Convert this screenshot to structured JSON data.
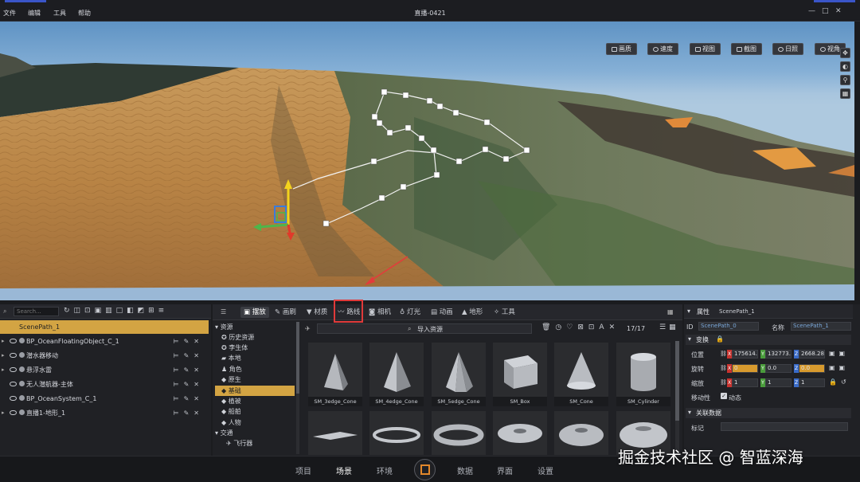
{
  "menu": {
    "items": [
      "文件",
      "编辑",
      "工具",
      "帮助"
    ],
    "title": "直播-0421",
    "window_controls": [
      "—",
      "□",
      "✕"
    ]
  },
  "viewport_toolbar": {
    "buttons": [
      {
        "label": "画质",
        "icon": "quality-icon"
      },
      {
        "label": "速度",
        "icon": "speed-icon"
      },
      {
        "label": "视图",
        "icon": "view-icon"
      },
      {
        "label": "截图",
        "icon": "camera-icon"
      },
      {
        "label": "日照",
        "icon": "sun-icon"
      },
      {
        "label": "视角",
        "icon": "eye-icon"
      }
    ],
    "side_tools": [
      "move-icon",
      "orbit-icon",
      "person-icon",
      "layers-icon"
    ]
  },
  "outliner": {
    "search_placeholder": "Search...",
    "items": [
      {
        "label": "ScenePath_1",
        "selected": true
      },
      {
        "label": "BP_OceanFloatingObject_C_1",
        "selected": false
      },
      {
        "label": "潜水器移动",
        "selected": false
      },
      {
        "label": "悬浮水雷",
        "selected": false
      },
      {
        "label": "无人潜航器-主体",
        "selected": false
      },
      {
        "label": "BP_OceanSystem_C_1",
        "selected": false
      },
      {
        "label": "直播1-地形_1",
        "selected": false
      }
    ]
  },
  "library": {
    "tabs": [
      {
        "label": "摆放",
        "active": true
      },
      {
        "label": "画刷",
        "active": false
      },
      {
        "label": "材质",
        "active": false
      },
      {
        "label": "路线",
        "active": false,
        "highlighted": true
      },
      {
        "label": "相机",
        "active": false
      },
      {
        "label": "灯光",
        "active": false
      },
      {
        "label": "动画",
        "active": false
      },
      {
        "label": "地形",
        "active": false
      },
      {
        "label": "工具",
        "active": false
      }
    ],
    "categories": [
      {
        "label": "资源",
        "selected": false
      },
      {
        "label": "历史资源",
        "selected": false
      },
      {
        "label": "李生体",
        "selected": false
      },
      {
        "label": "本地",
        "selected": false
      },
      {
        "label": "角色",
        "selected": false
      },
      {
        "label": "原生",
        "selected": false
      },
      {
        "label": "基础",
        "selected": true
      },
      {
        "label": "植被",
        "selected": false
      },
      {
        "label": "船舶",
        "selected": false
      },
      {
        "label": "人物",
        "selected": false
      },
      {
        "label": "交通",
        "selected": false
      },
      {
        "label": "飞行器",
        "selected": false
      }
    ],
    "import_label": "导入资源",
    "count": "17/17",
    "assets": [
      {
        "name": "SM_3edge_Cone"
      },
      {
        "name": "SM_4edge_Cone"
      },
      {
        "name": "SM_5edge_Cone"
      },
      {
        "name": "SM_Box"
      },
      {
        "name": "SM_Cone"
      },
      {
        "name": "SM_Cylinder"
      }
    ]
  },
  "properties": {
    "title": "属性",
    "object_name": "ScenePath_1",
    "id_label": "ID",
    "id_value": "ScenePath_0",
    "name_label": "名称",
    "name_value": "ScenePath_1",
    "transform_label": "变换",
    "position_label": "位置",
    "position": {
      "x": "175614.0",
      "y": "132773.4",
      "z": "2668.28544"
    },
    "rotation_label": "旋转",
    "rotation": {
      "x": "0",
      "y": "0.0",
      "z": "0.0"
    },
    "scale_label": "缩放",
    "scale": {
      "x": "1",
      "y": "1",
      "z": "1"
    },
    "mobility_label": "移动性",
    "mobility_value": "动态",
    "related_label": "关联数据",
    "tag_label": "标记"
  },
  "bottom_nav": {
    "items": [
      {
        "label": "项目",
        "active": false
      },
      {
        "label": "场景",
        "active": true
      },
      {
        "label": "环境",
        "active": false
      },
      {
        "label": "数据",
        "active": false
      },
      {
        "label": "界面",
        "active": false
      },
      {
        "label": "设置",
        "active": false
      }
    ]
  },
  "watermark": "掘金技术社区 @ 智蓝深海",
  "colors": {
    "accent": "#3a55c8",
    "selection": "#d3a443",
    "highlight_box": "#e03a3a"
  }
}
